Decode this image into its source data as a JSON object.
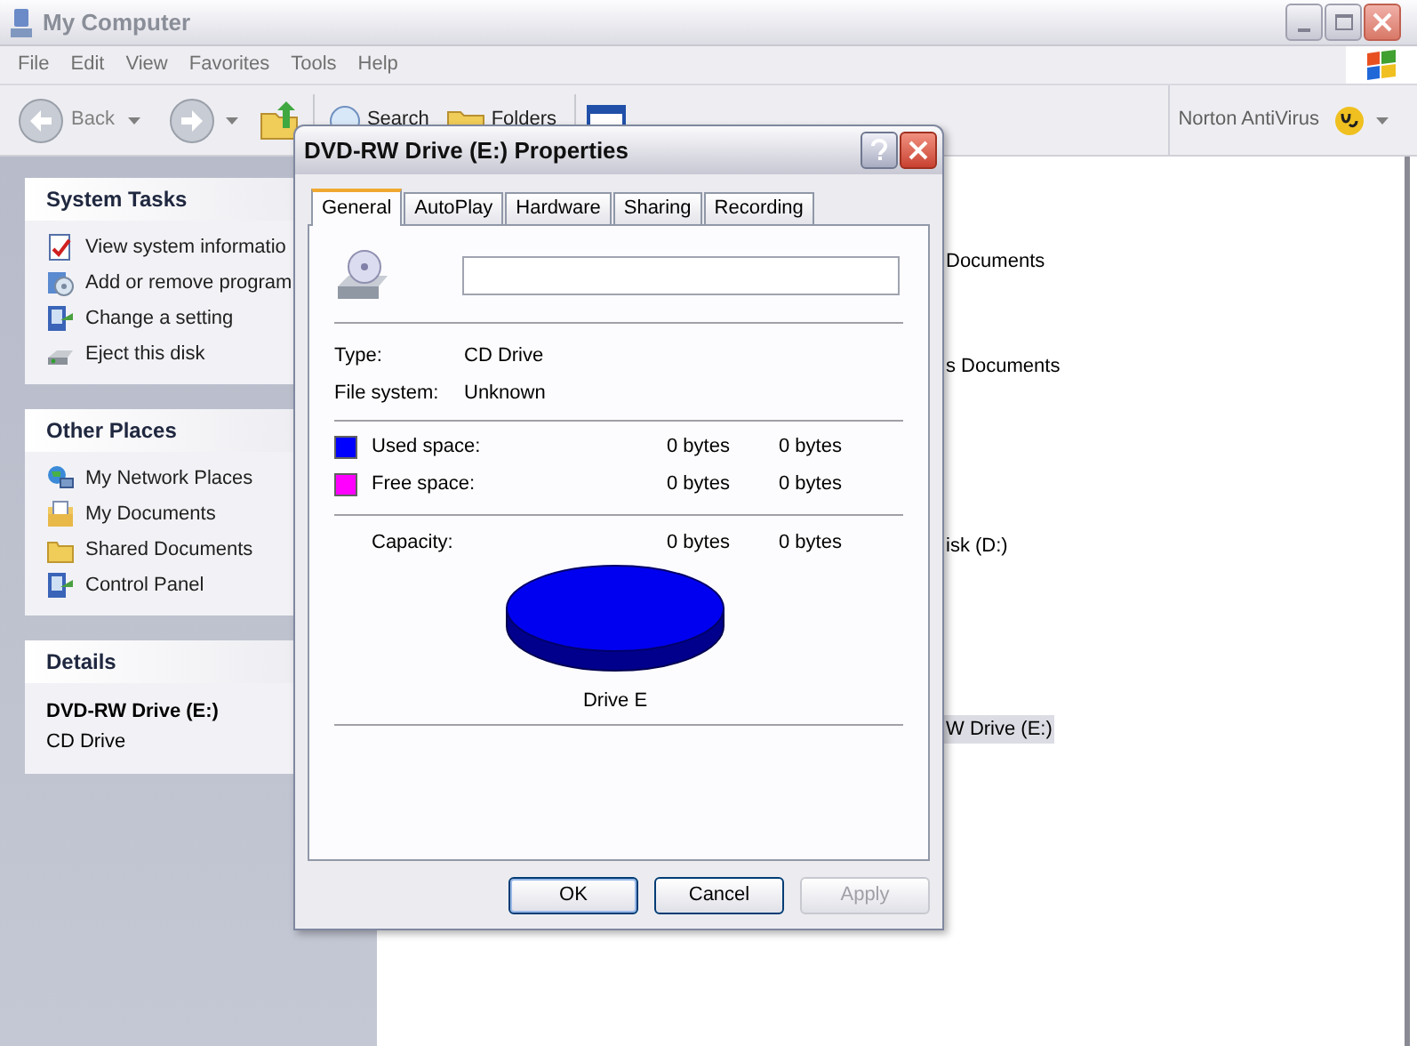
{
  "window": {
    "title": "My Computer"
  },
  "menu": [
    "File",
    "Edit",
    "View",
    "Favorites",
    "Tools",
    "Help"
  ],
  "toolbar": {
    "back": "Back",
    "search": "Search",
    "folders": "Folders",
    "norton": "Norton AntiVirus"
  },
  "sidebar": {
    "sections": [
      {
        "title": "System Tasks",
        "items": [
          {
            "label": "View system informatio",
            "kind": "info"
          },
          {
            "label": "Add or remove program",
            "kind": "programs"
          },
          {
            "label": "Change a setting",
            "kind": "panel"
          },
          {
            "label": "Eject this disk",
            "kind": "eject"
          }
        ]
      },
      {
        "title": "Other Places",
        "items": [
          {
            "label": "My Network Places",
            "kind": "network"
          },
          {
            "label": "My Documents",
            "kind": "documents"
          },
          {
            "label": "Shared Documents",
            "kind": "folder"
          },
          {
            "label": "Control Panel",
            "kind": "panel"
          }
        ]
      }
    ],
    "details": {
      "title": "Details",
      "name": "DVD-RW Drive (E:)",
      "type": "CD Drive"
    }
  },
  "content": {
    "items": [
      {
        "label": "Documents",
        "selected": false
      },
      {
        "label": "s Documents",
        "selected": false
      },
      {
        "label": "isk (D:)",
        "selected": false
      },
      {
        "label": "W Drive (E:)",
        "selected": true
      }
    ]
  },
  "dialog": {
    "title": "DVD-RW Drive (E:) Properties",
    "tabs": [
      {
        "label": "General",
        "selected": true
      },
      {
        "label": "AutoPlay",
        "selected": false
      },
      {
        "label": "Hardware",
        "selected": false
      },
      {
        "label": "Sharing",
        "selected": false
      },
      {
        "label": "Recording",
        "selected": false
      }
    ],
    "info": [
      {
        "label": "Type:",
        "value": "CD Drive"
      },
      {
        "label": "File system:",
        "value": "Unknown"
      }
    ],
    "space": [
      {
        "label": "Used space:",
        "color": "#0000ff",
        "bytes": "0 bytes",
        "size": "0 bytes"
      },
      {
        "label": "Free space:",
        "color": "#ff00ff",
        "bytes": "0 bytes",
        "size": "0 bytes"
      }
    ],
    "capacity": {
      "label": "Capacity:",
      "bytes": "0 bytes",
      "size": "0 bytes"
    },
    "drive_label": "Drive E",
    "buttons": [
      {
        "label": "OK",
        "disabled": false,
        "default": true
      },
      {
        "label": "Cancel",
        "disabled": false,
        "default": false
      },
      {
        "label": "Apply",
        "disabled": true,
        "default": false
      }
    ]
  }
}
